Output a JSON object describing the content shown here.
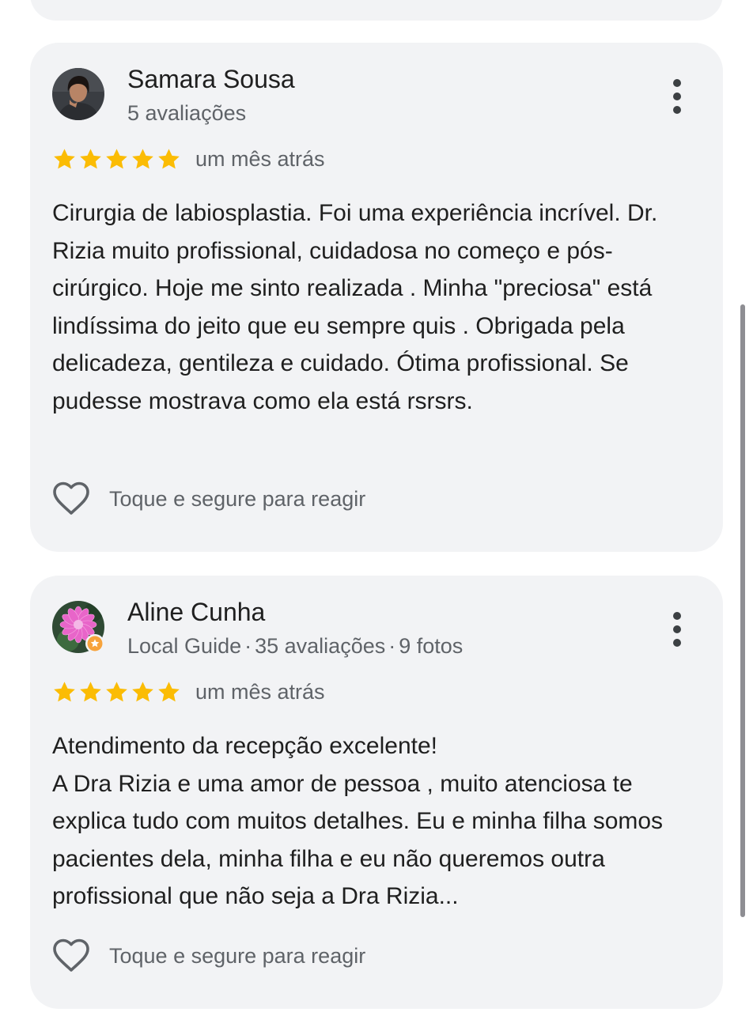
{
  "reviews": [
    {
      "name": "Samara Sousa",
      "meta": "5 avaliações",
      "rating": 5,
      "time": "um mês atrás",
      "text": [
        "Cirurgia de labiosplastia. Foi uma experiência incrível. Dr. Rizia muito profissional, cuidadosa no começo e pós-cirúrgico. Hoje me sinto realizada . Minha \"preciosa\" está lindíssima do jeito que eu sempre quis . Obrigada pela delicadeza, gentileza e cuidado. Ótima profissional. Se pudesse mostrava como ela está rsrsrs."
      ],
      "react_label": "Toque e segure para reagir",
      "avatar_icon": "person-photo"
    },
    {
      "name": "Aline Cunha",
      "meta_parts": [
        "Local Guide",
        "35 avaliações",
        "9 fotos"
      ],
      "meta_separator": "·",
      "rating": 5,
      "time": "um mês atrás",
      "text": [
        "Atendimento da recepção excelente!",
        "A Dra Rizia e uma amor de pessoa , muito atenciosa te explica tudo com muitos detalhes. Eu e minha filha somos pacientes dela, minha filha e eu não queremos outra profissional que não seja a Dra Rizia..."
      ],
      "react_label": "Toque e segure para reagir",
      "avatar_icon": "pink-flower-photo",
      "badge_icon": "local-guide-badge"
    }
  ],
  "colors": {
    "card_bg": "#f2f3f5",
    "star": "#fbbc04",
    "primary_text": "#1f1f1f",
    "secondary_text": "#5f6368"
  },
  "icons": [
    "more-vert-icon",
    "star-icon",
    "heart-outline-icon"
  ]
}
